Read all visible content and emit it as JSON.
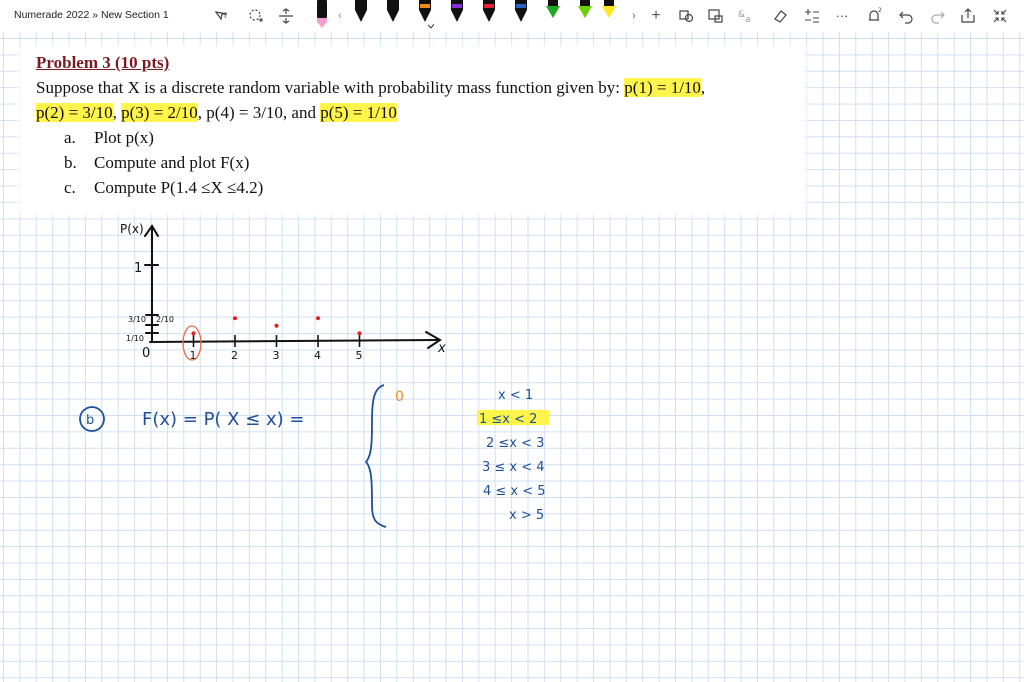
{
  "app": {
    "breadcrumb": "Numerade 2022 » New Section 1"
  },
  "toolbar": {
    "tools": [
      {
        "name": "select-lasso-icon",
        "glyph": "⭮"
      },
      {
        "name": "add-space-icon",
        "glyph": "⇕"
      }
    ],
    "pens": [
      {
        "name": "pen-pink",
        "color": "#f59fd0"
      },
      {
        "name": "pen-black-1",
        "color": "#111111"
      },
      {
        "name": "pen-black-2",
        "color": "#111111"
      },
      {
        "name": "pen-orange",
        "color": "#f28a1a"
      },
      {
        "name": "pen-purple",
        "color": "#8a2be2"
      },
      {
        "name": "pen-red",
        "color": "#e8213b"
      },
      {
        "name": "pen-blue",
        "color": "#2864c8"
      },
      {
        "name": "pen-green",
        "color": "#1fa81f"
      },
      {
        "name": "pen-lime",
        "color": "#c3e600"
      },
      {
        "name": "pen-yellow",
        "color": "#ffe81c"
      }
    ]
  },
  "problem": {
    "title": "Problem 3 (10 pts)",
    "intro": "Suppose that X is a discrete random variable with probability mass function given by: ",
    "pmf1": "p(1) = 1/10",
    "pmf_sep1": ",",
    "pmf2": "p(2) = 3/10",
    "pmf_sep2": ", ",
    "pmf3": "p(3) = 2/10",
    "pmf_sep3": ", p(4) = 3/10, and ",
    "pmf5": "p(5) = 1/10",
    "items": [
      {
        "letter": "a.",
        "text": "Plot p(x)"
      },
      {
        "letter": "b.",
        "text": "Compute and plot F(x)"
      },
      {
        "letter": "c.",
        "text": "Compute P(1.4 ≤X ≤4.2)"
      }
    ]
  },
  "handwriting": {
    "y_axis_label": "P(x)",
    "x_axis_label": "x",
    "y_tick_1": "1",
    "y_tick_3_10": "3/10",
    "y_tick_2_10": "2/10",
    "y_tick_1_10": "1/10",
    "origin": "0",
    "x_ticks": [
      "1",
      "2",
      "3",
      "4",
      "5"
    ],
    "part_b_marker": "b",
    "cdf_def": "F(x) =  P( X ≤ x)  =",
    "case_first_value": "0",
    "cases": [
      "x < 1",
      "1 ≤x < 2",
      "2 ≤x < 3",
      "3 ≤ x < 4",
      "4 ≤ x < 5",
      "x > 5"
    ]
  },
  "chart_data": {
    "type": "scatter",
    "title": "",
    "xlabel": "x",
    "ylabel": "P(x)",
    "x": [
      1,
      2,
      3,
      4,
      5
    ],
    "y": [
      0.1,
      0.3,
      0.2,
      0.3,
      0.1
    ],
    "xlim": [
      0,
      5
    ],
    "ylim": [
      0,
      1
    ]
  },
  "colors": {
    "accent": "#1e4f9c",
    "highlight": "#fff44a",
    "title": "#7b1a22",
    "points": "#e02020"
  }
}
